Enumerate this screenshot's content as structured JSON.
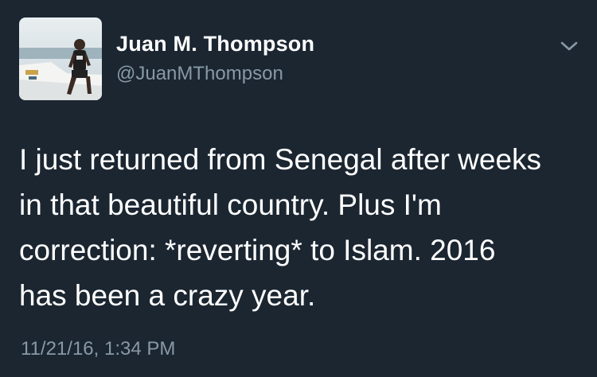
{
  "theme": {
    "background": "#1b2631",
    "text": "#ffffff",
    "muted": "#8899a6"
  },
  "tweet": {
    "display_name": "Juan M. Thompson",
    "handle": "@JuanMThompson",
    "avatar_icon": "profile-photo",
    "menu_icon": "chevron-down-icon",
    "text_lines": [
      "I just returned from Senegal after weeks",
      "in that beautiful country. Plus I'm",
      "correction: *reverting* to Islam. 2016",
      "has been a crazy year."
    ],
    "timestamp": "11/21/16, 1:34 PM"
  }
}
